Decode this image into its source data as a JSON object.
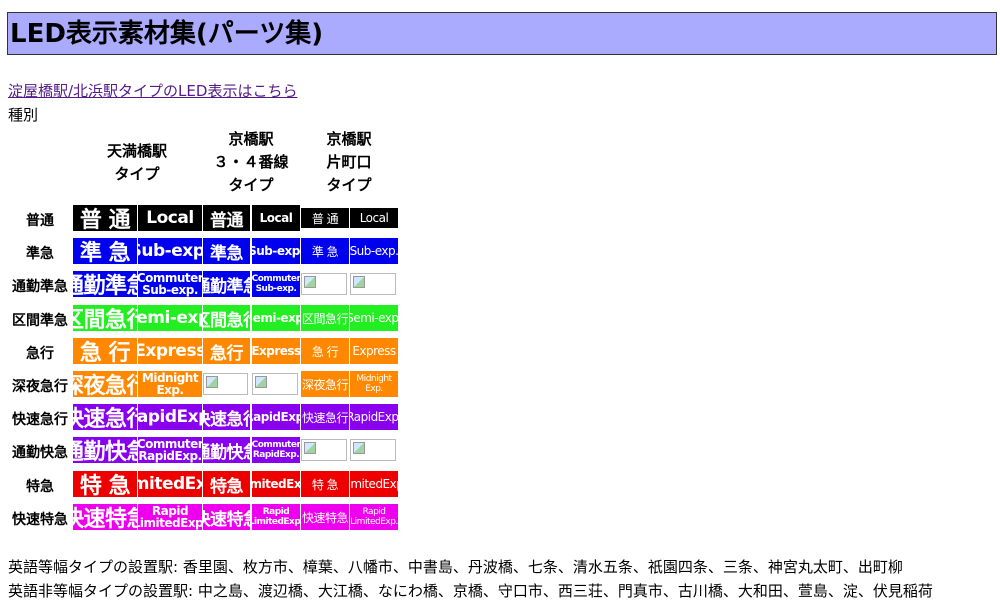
{
  "title": "LED表示素材集(パーツ集)",
  "link_text": "淀屋橋駅/北浜駅タイプのLED表示はこちら",
  "section_label": "種別",
  "headers": [
    {
      "lines": [
        "天満橋駅",
        "タイプ"
      ]
    },
    {
      "lines": [
        "京橋駅",
        "３・４番線",
        "タイプ"
      ]
    },
    {
      "lines": [
        "京橋駅",
        "片町口",
        "タイプ"
      ]
    }
  ],
  "broken_image_icon": "broken-image-icon",
  "rows": [
    {
      "label": "普通",
      "color": "#000000",
      "cells": [
        "普 通",
        "Local",
        "普通",
        "Local",
        "普 通",
        "Local"
      ]
    },
    {
      "label": "準急",
      "color": "#0000ee",
      "cells": [
        "準 急",
        "Sub-exp.",
        "準急",
        "Sub-exp.",
        "準 急",
        "Sub-exp."
      ]
    },
    {
      "label": "通勤準急",
      "color": "#0000ee",
      "cells": [
        "通勤準急",
        "Commuter|Sub-exp.",
        "通勤準急",
        "Commuter|Sub-exp.",
        null,
        null
      ]
    },
    {
      "label": "区間準急",
      "color": "#22ee22",
      "cells": [
        "区間急行",
        "Semi-exp.",
        "区間急行",
        "Semi-exp.",
        "区間急行",
        "Semi-exp."
      ]
    },
    {
      "label": "急行",
      "color": "#ff8800",
      "cells": [
        "急 行",
        "Express",
        "急行",
        "Express",
        "急 行",
        "Express"
      ]
    },
    {
      "label": "深夜急行",
      "color": "#ff8800",
      "cells": [
        "深夜急行",
        "Midnight|Exp.",
        null,
        null,
        "深夜急行",
        "Midnight|Exp."
      ]
    },
    {
      "label": "快速急行",
      "color": "#8800ee",
      "cells": [
        "快速急行",
        "RapidExp.",
        "快速急行",
        "RapidExp.",
        "快速急行",
        "RapidExp."
      ]
    },
    {
      "label": "通勤快急",
      "color": "#8800ee",
      "cells": [
        "通勤快急",
        "Commuter|RapidExp.",
        "通勤快急",
        "Commuter|RapidExp.",
        null,
        null
      ]
    },
    {
      "label": "特急",
      "color": "#ee0000",
      "cells": [
        "特 急",
        "LimitedExp.",
        "特急",
        "LimitedExp.",
        "特 急",
        "LimitedExp."
      ]
    },
    {
      "label": "快速特急",
      "color": "#ee00ee",
      "cells": [
        "快速特急",
        "Rapid|LimitedExp.",
        "快速特急",
        "Rapid|LimitedExp.",
        "快速特急",
        "Rapid|LimitedExp."
      ]
    }
  ],
  "footer": [
    "英語等幅タイプの設置駅: 香里園、枚方市、樟葉、八幡市、中書島、丹波橋、七条、清水五条、祇園四条、三条、神宮丸太町、出町柳",
    "英語非等幅タイプの設置駅: 中之島、渡辺橋、大江橋、なにわ橋、京橋、守口市、西三荘、門真市、古川橋、大和田、萱島、淀、伏見稲荷"
  ]
}
